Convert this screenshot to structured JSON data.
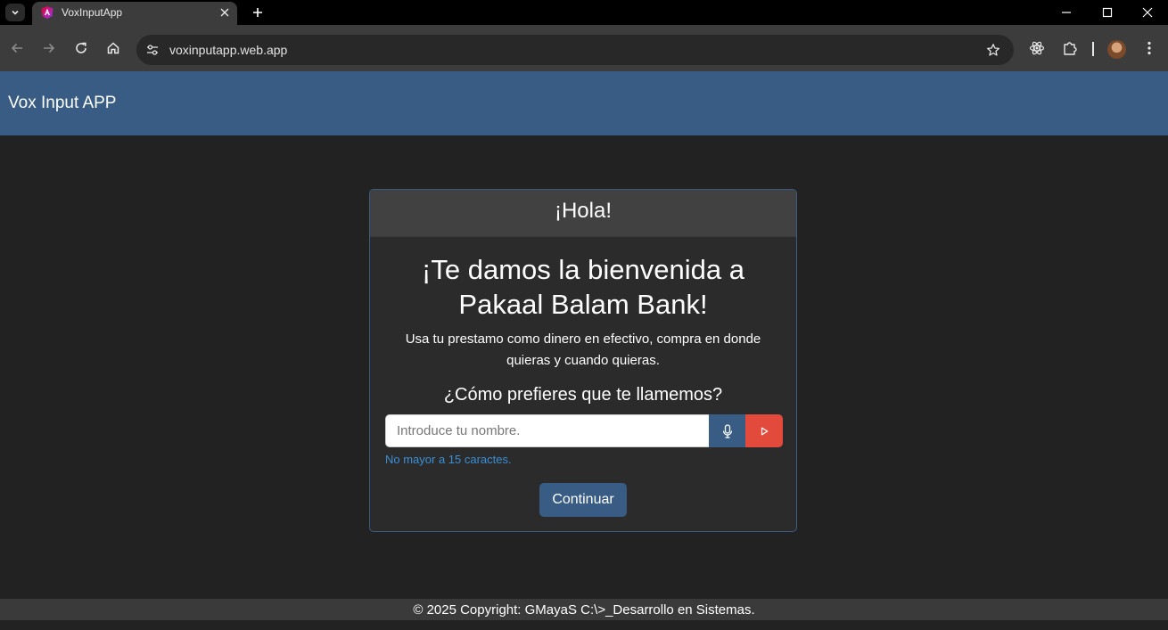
{
  "browser": {
    "tab_title": "VoxInputApp",
    "url": "voxinputapp.web.app"
  },
  "icons": {
    "tab_list": "chevron-down-icon",
    "favicon": "angular-favicon-icon",
    "tab_close": "close-icon",
    "new_tab": "plus-icon",
    "minimize": "minimize-icon",
    "maximize": "maximize-icon",
    "close_window": "close-icon",
    "back": "arrow-left-icon",
    "forward": "arrow-right-icon",
    "reload": "reload-icon",
    "home": "home-icon",
    "site_info": "tune-icon",
    "bookmark": "star-icon",
    "react_devtools": "react-icon",
    "extensions": "puzzle-icon",
    "menu": "more-vertical-icon",
    "mic": "microphone-icon",
    "send": "play-icon"
  },
  "app": {
    "title": "Vox Input APP"
  },
  "card": {
    "header": "¡Hola!",
    "welcome": "¡Te damos la bienvenida a Pakaal Balam Bank!",
    "subtitle": "Usa tu prestamo como dinero en efectivo, compra en donde quieras y cuando quieras.",
    "question": "¿Cómo prefieres que te llamemos?",
    "input_placeholder": "Introduce tu nombre.",
    "input_value": "",
    "hint": "No mayor a 15 caractes.",
    "continue_label": "Continuar"
  },
  "footer": {
    "text": "© 2025 Copyright: GMayaS C:\\>_Desarrollo en Sistemas."
  },
  "colors": {
    "header_bg": "#385c83",
    "page_bg": "#222222",
    "card_bg": "#2b2b2b",
    "card_header_bg": "#414141",
    "accent_red": "#e24b3c",
    "hint_blue": "#3a8fd6"
  }
}
